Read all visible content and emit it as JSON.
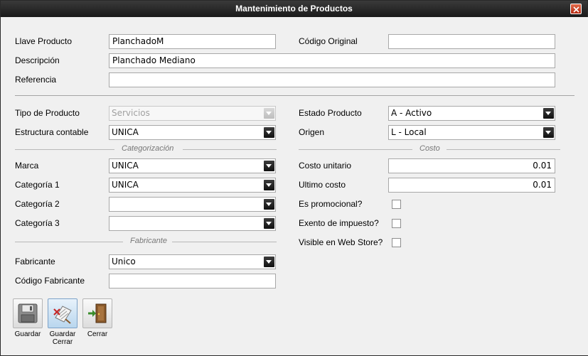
{
  "window": {
    "title": "Mantenimiento de Productos"
  },
  "fields": {
    "llave_producto": {
      "label": "Llave Producto",
      "value": "PlanchadoM"
    },
    "codigo_original": {
      "label": "Código Original",
      "value": ""
    },
    "descripcion": {
      "label": "Descripción",
      "value": "Planchado Mediano"
    },
    "referencia": {
      "label": "Referencia",
      "value": ""
    },
    "tipo_producto": {
      "label": "Tipo de Producto",
      "value": "Servicios"
    },
    "estado_producto": {
      "label": "Estado Producto",
      "value": "A - Activo"
    },
    "estructura_contable": {
      "label": "Estructura contable",
      "value": "UNICA"
    },
    "origen": {
      "label": "Origen",
      "value": "L - Local"
    }
  },
  "categorizacion": {
    "title": "Categorización",
    "marca": {
      "label": "Marca",
      "value": "UNICA"
    },
    "categoria1": {
      "label": "Categoría 1",
      "value": "UNICA"
    },
    "categoria2": {
      "label": "Categoría 2",
      "value": ""
    },
    "categoria3": {
      "label": "Categoría 3",
      "value": ""
    }
  },
  "costo": {
    "title": "Costo",
    "costo_unitario": {
      "label": "Costo unitario",
      "value": "0.01"
    },
    "ultimo_costo": {
      "label": "Ultimo costo",
      "value": "0.01"
    },
    "es_promocional": {
      "label": "Es promocional?",
      "checked": false
    },
    "exento_impuesto": {
      "label": "Exento de impuesto?",
      "checked": false
    },
    "visible_web_store": {
      "label": "Visible en Web Store?",
      "checked": false
    }
  },
  "fabricante_section": {
    "title": "Fabricante",
    "fabricante": {
      "label": "Fabricante",
      "value": "Unico"
    },
    "codigo_fabricante": {
      "label": "Código Fabricante",
      "value": ""
    }
  },
  "toolbar": {
    "guardar": {
      "label": "Guardar",
      "icon": "floppy-disk-icon"
    },
    "guardar_cerrar": {
      "label": "Guardar Cerrar",
      "line1": "Guardar",
      "line2": "Cerrar",
      "icon": "save-close-icon"
    },
    "cerrar": {
      "label": "Cerrar",
      "icon": "exit-door-icon"
    }
  },
  "colors": {
    "titlebar": "#1a1a1a",
    "close_button": "#c4391c",
    "background": "#f0f0f0",
    "combo_button": "#111111"
  }
}
